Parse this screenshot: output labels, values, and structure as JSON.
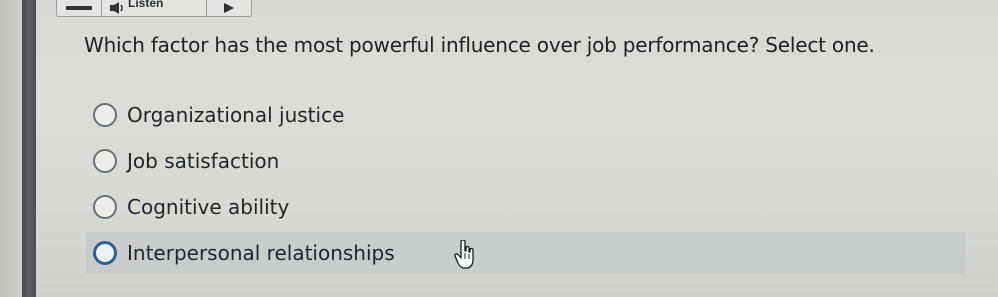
{
  "toolbar": {
    "menu_icon": "hamburger-icon",
    "speaker_icon": "speaker-icon",
    "listen_label": "Listen",
    "play_icon": "play-icon"
  },
  "question": {
    "text": "Which factor has the most powerful influence over job performance? Select one."
  },
  "options": [
    {
      "label": "Organizational justice",
      "selected": false
    },
    {
      "label": "Job satisfaction",
      "selected": false
    },
    {
      "label": "Cognitive ability",
      "selected": false
    },
    {
      "label": "Interpersonal relationships",
      "selected": false,
      "hovered": true
    }
  ],
  "cursor": {
    "icon": "hand-pointer-icon"
  },
  "colors": {
    "background": "#dadbd7",
    "left_bar": "#52555d",
    "radio_border": "#6b6e74",
    "radio_hover_border": "#2f5f9a",
    "text": "#1e2024"
  }
}
